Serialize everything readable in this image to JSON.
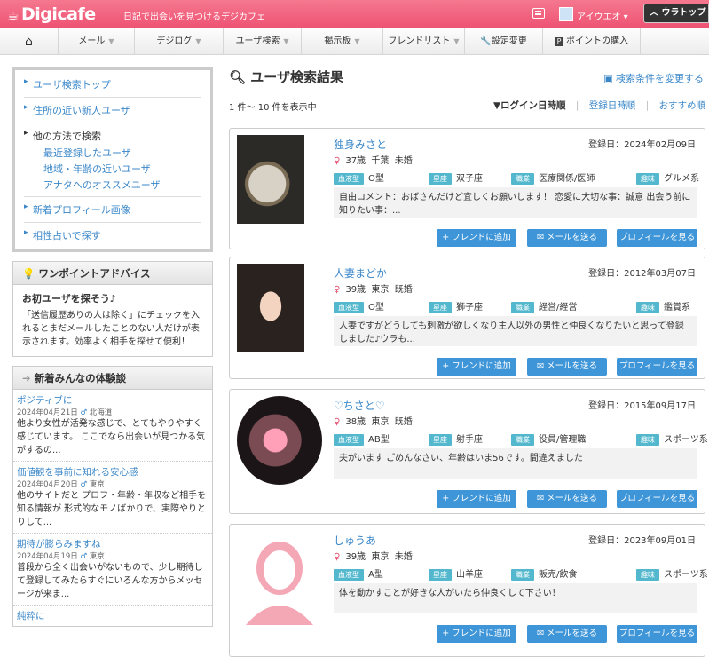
{
  "header": {
    "logo": "Digicafe",
    "tagline": "日記で出会いを見つけるデジカフェ",
    "username": "アイウエオ",
    "top_link": "ウラトップ",
    "nav": [
      {
        "label": "⌂"
      },
      {
        "label": "メール"
      },
      {
        "label": "デジログ"
      },
      {
        "label": "ユーザ検索"
      },
      {
        "label": "掲示板"
      },
      {
        "label": "フレンドリスト"
      },
      {
        "label": "設定変更"
      },
      {
        "label": "ポイントの購入"
      }
    ]
  },
  "sidebar": {
    "links": [
      {
        "label": "ユーザ検索トップ"
      },
      {
        "label": "住所の近い新人ユーザ"
      }
    ],
    "other_label": "他の方法で検索",
    "other_links": [
      {
        "label": "最近登録したユーザ"
      },
      {
        "label": "地域・年齢の近いユーザ"
      },
      {
        "label": "アナタへのオススメユーザ"
      }
    ],
    "links2": [
      {
        "label": "新着プロフィール画像"
      },
      {
        "label": "相性占いで探す"
      }
    ],
    "advice": {
      "title": "ワンポイントアドバイス",
      "heading": "お初ユーザを探そう♪",
      "body": "「送信履歴ありの人は除く」にチェックを入れるとまだメールしたことのない人だけが表示されます。効率よく相手を探せて便利！"
    },
    "experiences": {
      "title": "新着みんなの体験談",
      "items": [
        {
          "title": "ポジティブに",
          "date": "2024年04月21日",
          "loc": "北海道",
          "text": "他より女性が活発な感じで、とてもやりやすく感じています。 ここでなら出会いが見つかる気がするの..."
        },
        {
          "title": "価値観を事前に知れる安心感",
          "date": "2024年04月20日",
          "loc": "東京",
          "text": "他のサイトだと プロフ・年齢・年収など相手を知る情報が 形式的なモノばかりで、実際やりとりして..."
        },
        {
          "title": "期待が膨らみますね",
          "date": "2024年04月19日",
          "loc": "東京",
          "text": "普段から全く出会いがないもので、少し期待して登録してみたらすぐにいろんな方からメッセージが来ま..."
        },
        {
          "title": "純粋に",
          "date": "",
          "loc": "",
          "text": ""
        }
      ]
    }
  },
  "main": {
    "title": "ユーザ検索結果",
    "change_cond": "検索条件を変更する",
    "count": "1 件～ 10 件を表示中",
    "sorts": {
      "active": "▼ログイン日時順",
      "s2": "登録日時順",
      "s3": "おすすめ順"
    },
    "labels": {
      "blood": "血液型",
      "star": "星座",
      "job": "職業",
      "hobby": "趣味",
      "reg": "登録日：",
      "btn_friend": "フレンドに追加",
      "btn_mail": "メールを送る",
      "btn_profile": "プロフィールを見る"
    },
    "users": [
      {
        "name": "独身みさと",
        "reg_date": "2024年02月09日",
        "sex": "♀",
        "age": "37歳",
        "pref": "千葉",
        "status": "未婚",
        "blood": "O型",
        "star": "双子座",
        "job": "医療関係/医師",
        "hobby": "グルメ系",
        "comment": "自由コメント：おばさんだけど宜しくお願いします！ 恋愛に大切な事：誠意 出会う前に知りたい事：..."
      },
      {
        "name": "人妻まどか",
        "reg_date": "2012年03月07日",
        "sex": "♀",
        "age": "39歳",
        "pref": "東京",
        "status": "既婚",
        "blood": "O型",
        "star": "獅子座",
        "job": "経営/経営",
        "hobby": "鑑賞系",
        "comment": "人妻ですがどうしても刺激が欲しくなり主人以外の男性と仲良くなりたいと思って登録しました♪ウラも..."
      },
      {
        "name": "♡ちさと♡",
        "reg_date": "2015年09月17日",
        "sex": "♀",
        "age": "38歳",
        "pref": "東京",
        "status": "既婚",
        "blood": "AB型",
        "star": "射手座",
        "job": "役員/管理職",
        "hobby": "スポーツ系",
        "comment": "夫がいます ごめんなさい、年齢はいま56です。間違えました"
      },
      {
        "name": "しゅうあ",
        "reg_date": "2023年09月01日",
        "sex": "♀",
        "age": "39歳",
        "pref": "東京",
        "status": "未婚",
        "blood": "A型",
        "star": "山羊座",
        "job": "販売/飲食",
        "hobby": "スポーツ系",
        "comment": "体を動かすことが好きな人がいたら仲良くして下さい！"
      }
    ]
  }
}
